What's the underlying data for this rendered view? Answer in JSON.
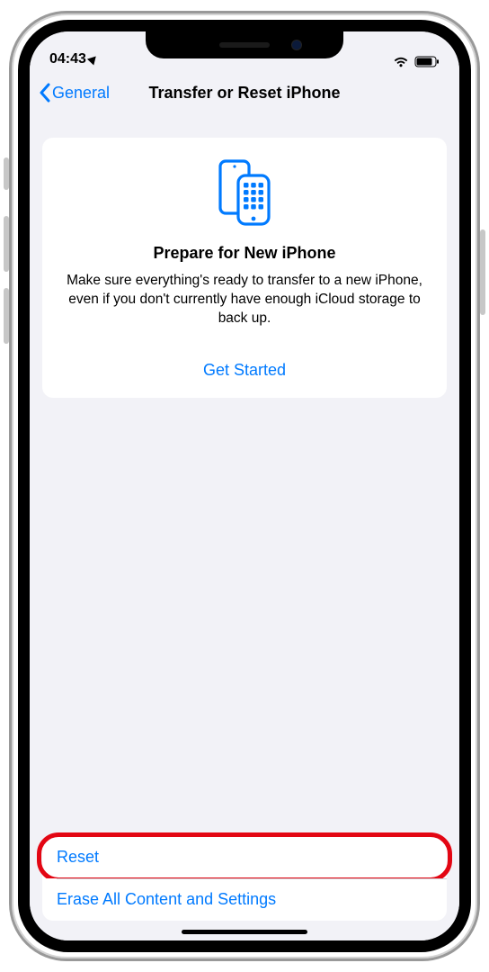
{
  "status": {
    "time": "04:43"
  },
  "nav": {
    "back_label": "General",
    "title": "Transfer or Reset iPhone"
  },
  "prepare_card": {
    "title": "Prepare for New iPhone",
    "description": "Make sure everything's ready to transfer to a new iPhone, even if you don't currently have enough iCloud storage to back up.",
    "cta": "Get Started"
  },
  "actions": {
    "reset": "Reset",
    "erase": "Erase All Content and Settings"
  },
  "colors": {
    "blue": "#007aff",
    "red_highlight": "#e30613"
  }
}
